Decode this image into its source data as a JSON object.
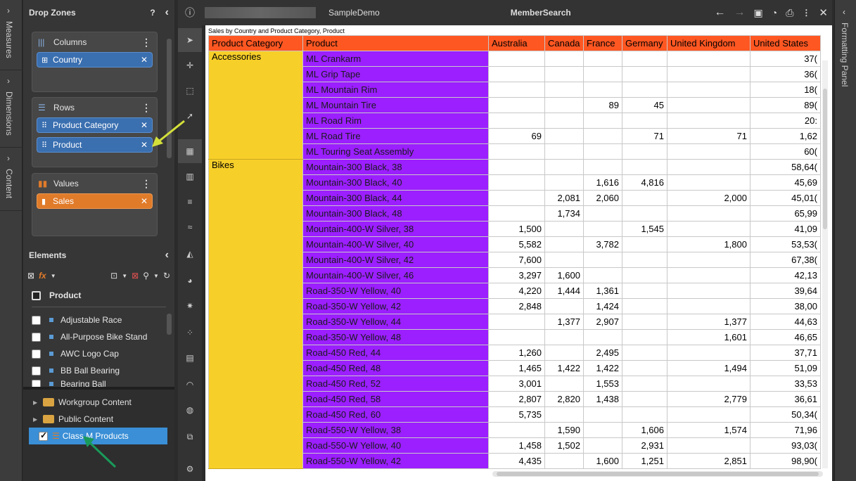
{
  "rail": {
    "items": [
      "Measures",
      "Dimensions",
      "Content"
    ]
  },
  "right_rail": {
    "label": "Formatting Panel"
  },
  "drop_zones": {
    "title": "Drop Zones",
    "help": "?",
    "columns": {
      "title": "Columns",
      "pills": [
        "Country"
      ]
    },
    "rows": {
      "title": "Rows",
      "pills": [
        "Product Category",
        "Product"
      ]
    },
    "values": {
      "title": "Values",
      "pills": [
        "Sales"
      ]
    }
  },
  "elements": {
    "title": "Elements",
    "header_item": "Product",
    "items": [
      "Adjustable Race",
      "All-Purpose Bike Stand",
      "AWC Logo Cap",
      "BB Ball Bearing",
      "Bearing Ball"
    ]
  },
  "tree": {
    "items": [
      "Workgroup Content",
      "Public Content",
      "Class M Products"
    ]
  },
  "topbar": {
    "info": "ⓘ",
    "demo_name": "SampleDemo",
    "title": "MemberSearch"
  },
  "grid": {
    "title": "Sales by Country and Product Category, Product",
    "headers": [
      "Product Category",
      "Product",
      "Australia",
      "Canada",
      "France",
      "Germany",
      "United Kingdom",
      "United States"
    ],
    "groups": [
      {
        "category": "Accessories",
        "rows": [
          [
            "ML Crankarm",
            "",
            "",
            "",
            "",
            "",
            "37("
          ],
          [
            "ML Grip Tape",
            "",
            "",
            "",
            "",
            "",
            "36("
          ],
          [
            "ML Mountain Rim",
            "",
            "",
            "",
            "",
            "",
            "18("
          ],
          [
            "ML Mountain Tire",
            "",
            "",
            "89",
            "45",
            "",
            "89("
          ],
          [
            "ML Road Rim",
            "",
            "",
            "",
            "",
            "",
            "20:"
          ],
          [
            "ML Road Tire",
            "69",
            "",
            "",
            "71",
            "71",
            "1,62"
          ],
          [
            "ML Touring Seat Assembly",
            "",
            "",
            "",
            "",
            "",
            "60("
          ]
        ]
      },
      {
        "category": "Bikes",
        "rows": [
          [
            "Mountain-300 Black, 38",
            "",
            "",
            "",
            "",
            "",
            "58,64("
          ],
          [
            "Mountain-300 Black, 40",
            "",
            "",
            "1,616",
            "4,816",
            "",
            "45,69"
          ],
          [
            "Mountain-300 Black, 44",
            "",
            "2,081",
            "2,060",
            "",
            "2,000",
            "45,01("
          ],
          [
            "Mountain-300 Black, 48",
            "",
            "1,734",
            "",
            "",
            "",
            "65,99"
          ],
          [
            "Mountain-400-W Silver, 38",
            "1,500",
            "",
            "",
            "1,545",
            "",
            "41,09"
          ],
          [
            "Mountain-400-W Silver, 40",
            "5,582",
            "",
            "3,782",
            "",
            "1,800",
            "53,53("
          ],
          [
            "Mountain-400-W Silver, 42",
            "7,600",
            "",
            "",
            "",
            "",
            "67,38("
          ],
          [
            "Mountain-400-W Silver, 46",
            "3,297",
            "1,600",
            "",
            "",
            "",
            "42,13"
          ],
          [
            "Road-350-W Yellow, 40",
            "4,220",
            "1,444",
            "1,361",
            "",
            "",
            "39,64"
          ],
          [
            "Road-350-W Yellow, 42",
            "2,848",
            "",
            "1,424",
            "",
            "",
            "38,00"
          ],
          [
            "Road-350-W Yellow, 44",
            "",
            "1,377",
            "2,907",
            "",
            "1,377",
            "44,63"
          ],
          [
            "Road-350-W Yellow, 48",
            "",
            "",
            "",
            "",
            "1,601",
            "46,65"
          ],
          [
            "Road-450 Red, 44",
            "1,260",
            "",
            "2,495",
            "",
            "",
            "37,71"
          ],
          [
            "Road-450 Red, 48",
            "1,465",
            "1,422",
            "1,422",
            "",
            "1,494",
            "51,09"
          ],
          [
            "Road-450 Red, 52",
            "3,001",
            "",
            "1,553",
            "",
            "",
            "33,53"
          ],
          [
            "Road-450 Red, 58",
            "2,807",
            "2,820",
            "1,438",
            "",
            "2,779",
            "36,61"
          ],
          [
            "Road-450 Red, 60",
            "5,735",
            "",
            "",
            "",
            "",
            "50,34("
          ],
          [
            "Road-550-W Yellow, 38",
            "",
            "1,590",
            "",
            "1,606",
            "1,574",
            "71,96"
          ],
          [
            "Road-550-W Yellow, 40",
            "1,458",
            "1,502",
            "",
            "2,931",
            "",
            "93,03("
          ],
          [
            "Road-550-W Yellow, 42",
            "4,435",
            "",
            "1,600",
            "1,251",
            "2,851",
            "98,90("
          ]
        ]
      }
    ]
  },
  "colors": {
    "header": "#ff5722",
    "product": "#9b1fff",
    "category": "#f7cf29",
    "pill_blue": "#3a6fb0",
    "pill_orange": "#e07b2a",
    "arrow_yellow": "#d4e03a",
    "arrow_green": "#1a9a5a"
  }
}
